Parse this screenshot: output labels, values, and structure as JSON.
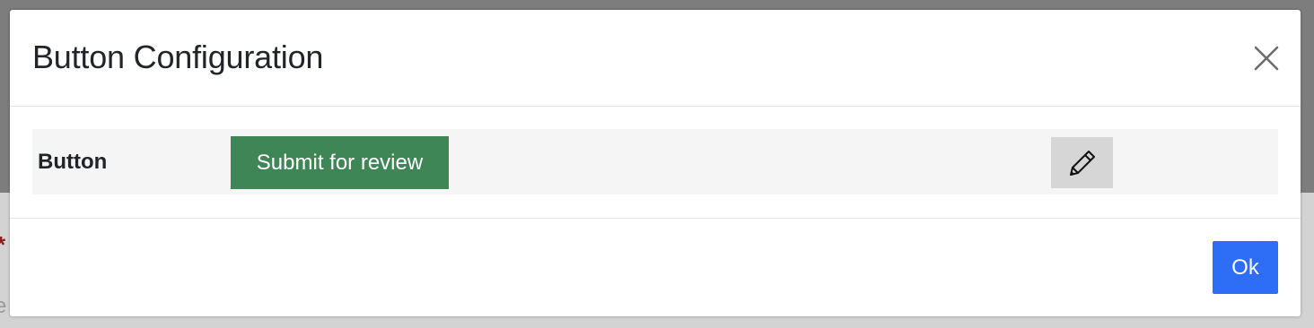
{
  "dialog": {
    "title": "Button Configuration",
    "close_icon": "close-icon"
  },
  "config_row": {
    "label": "Button",
    "preview_button_label": "Submit for review",
    "preview_button_color": "#3f8656",
    "edit_icon": "pencil-icon"
  },
  "footer": {
    "ok_label": "Ok",
    "ok_color": "#2e6df6"
  }
}
